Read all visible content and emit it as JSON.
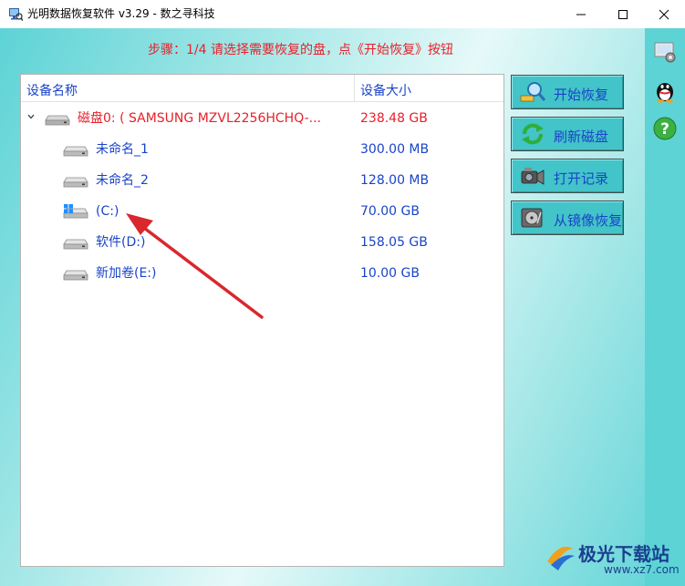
{
  "window": {
    "title": "光明数据恢复软件 v3.29 - 数之寻科技"
  },
  "step": {
    "text": "步骤：1/4 请选择需要恢复的盘，点《开始恢复》按钮"
  },
  "table": {
    "headers": {
      "name": "设备名称",
      "size": "设备大小"
    },
    "rows": [
      {
        "name": "磁盘0: ( SAMSUNG MZVL2256HCHQ-...",
        "size": "238.48 GB",
        "kind": "disk",
        "icon": "hdd-icon"
      },
      {
        "name": "未命名_1",
        "size": "300.00 MB",
        "kind": "partition",
        "icon": "drive-icon"
      },
      {
        "name": "未命名_2",
        "size": "128.00 MB",
        "kind": "partition",
        "icon": "drive-icon"
      },
      {
        "name": "(C:)",
        "size": "70.00 GB",
        "kind": "partition",
        "icon": "windows-icon"
      },
      {
        "name": "软件(D:)",
        "size": "158.05 GB",
        "kind": "partition",
        "icon": "drive-icon"
      },
      {
        "name": "新加卷(E:)",
        "size": "10.00 GB",
        "kind": "partition",
        "icon": "drive-icon"
      }
    ]
  },
  "actions": {
    "start": "开始恢复",
    "refresh": "刷新磁盘",
    "open_record": "打开记录",
    "from_image": "从镜像恢复"
  },
  "watermark": {
    "text": "极光下载站",
    "url": "www.xz7.com"
  },
  "colors": {
    "accent_red": "#e8202a",
    "text_blue": "#1a44c8",
    "button_teal": "#43c4c8"
  }
}
